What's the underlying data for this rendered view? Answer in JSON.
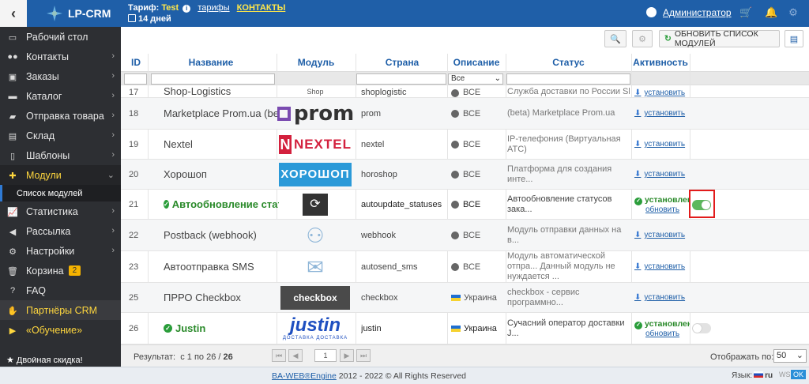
{
  "topbar": {
    "back_icon": "chevron-left-icon",
    "brand": "LP-CRM",
    "tariff_label": "Тариф:",
    "tariff_name": "Test",
    "tariffs_link": "тарифы",
    "contacts_link": "КОНТАКТЫ",
    "days": "14 дней",
    "user": "Администратор"
  },
  "sidebar": {
    "items": [
      {
        "label": "Рабочий стол",
        "icon": "desktop-icon"
      },
      {
        "label": "Контакты",
        "icon": "users-icon"
      },
      {
        "label": "Заказы",
        "icon": "money-icon"
      },
      {
        "label": "Каталог",
        "icon": "inbox-icon"
      },
      {
        "label": "Отправка товара",
        "icon": "truck-icon"
      },
      {
        "label": "Склад",
        "icon": "box-icon"
      },
      {
        "label": "Шаблоны",
        "icon": "file-icon"
      },
      {
        "label": "Модули",
        "icon": "puzzle-icon"
      },
      {
        "label": "Статистика",
        "icon": "chart-icon"
      },
      {
        "label": "Рассылка",
        "icon": "bullhorn-icon"
      },
      {
        "label": "Настройки",
        "icon": "gear-icon"
      },
      {
        "label": "Корзина",
        "icon": "trash-icon",
        "badge": "2"
      },
      {
        "label": "FAQ",
        "icon": "question-icon"
      },
      {
        "label": "Партнёры CRM",
        "icon": "handshake-icon"
      },
      {
        "label": "«Обучение»",
        "icon": "youtube-icon"
      }
    ],
    "sub_item": "Список модулей",
    "bottom_item": "Двойная скидка!"
  },
  "toolbar": {
    "refresh_label": "ОБНОВИТЬ СПИСОК МОДУЛЕЙ"
  },
  "table": {
    "headers": {
      "id": "ID",
      "name": "Название",
      "module": "Модуль",
      "country": "Страна",
      "description": "Описание",
      "status": "Статус",
      "activity": "Активность"
    },
    "country_filter": "Все",
    "rows": [
      {
        "id": "17",
        "name": "Shop-Logistics",
        "module": "shoplogistic",
        "country": "ВСЕ",
        "desc": "Служба доставки по России Sh...",
        "status": "установить",
        "logo": "shop"
      },
      {
        "id": "18",
        "name": "Marketplace Prom.ua (beta)",
        "module": "prom",
        "country": "ВСЕ",
        "desc": "(beta) Marketplace Prom.ua",
        "status": "установить",
        "logo": "prom"
      },
      {
        "id": "19",
        "name": "Nextel",
        "module": "nextel",
        "country": "ВСЕ",
        "desc": "IP-телефония (Виртуальная АТС)",
        "status": "установить",
        "logo": "nextel"
      },
      {
        "id": "20",
        "name": "Хорошоп",
        "module": "horoshop",
        "country": "ВСЕ",
        "desc": "Платформа для создания инте...",
        "status": "установить",
        "logo": "horoshop"
      },
      {
        "id": "21",
        "name": "Автообновление статусов",
        "module": "autoupdate_statuses",
        "country": "ВСЕ",
        "desc": "Автообновление статусов зака...",
        "status": "установлен",
        "update": "обновить",
        "installed": true,
        "toggle": "on",
        "logo": "auto"
      },
      {
        "id": "22",
        "name": "Postback (webhook)",
        "module": "webhook",
        "country": "ВСЕ",
        "desc": "Модуль отправки данных на в...",
        "status": "установить",
        "logo": "webhook"
      },
      {
        "id": "23",
        "name": "Автоотправка SMS",
        "module": "autosend_sms",
        "country": "ВСЕ",
        "desc": "Модуль автоматической отпра... Данный модуль не нуждается ...",
        "status": "установить",
        "logo": "sms"
      },
      {
        "id": "25",
        "name": "ПРРО Checkbox",
        "module": "checkbox",
        "country": "Украина",
        "desc": "checkbox - сервис программно...",
        "status": "установить",
        "logo": "checkbox"
      },
      {
        "id": "26",
        "name": "Justin",
        "module": "justin",
        "country": "Украина",
        "desc": "Сучасний оператор доставки J...",
        "status": "установлен",
        "update": "обновить",
        "installed": true,
        "toggle": "off",
        "logo": "justin"
      }
    ]
  },
  "logos": {
    "prom": "prom",
    "nextel": "NEXTEL",
    "horoshop": "ХОРОШОП",
    "checkbox": "checkbox",
    "justin": "justin",
    "justin_sub": "ДОСТАВКА ДОСТАВКА",
    "shop": "Shop"
  },
  "footer": {
    "result_label": "Результат:",
    "result_range": "с 1 по 26 /",
    "result_total": "26",
    "page": "1",
    "per_page_label": "Отображать по:",
    "per_page": "50"
  },
  "bottom": {
    "copyright_link": "BA-WEB®Engine",
    "copyright_rest": " 2012 - 2022 © All Rights Reserved",
    "lang_label": "Язык:",
    "lang": "ru",
    "ws": "WS:",
    "ok": "OK"
  }
}
